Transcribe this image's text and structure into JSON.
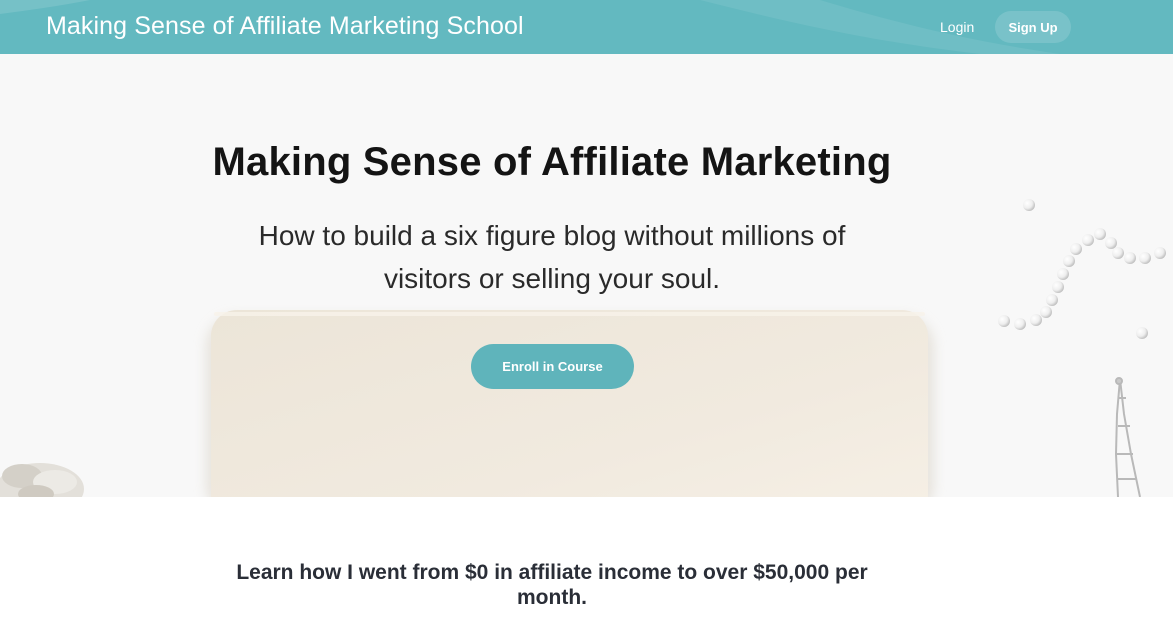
{
  "header": {
    "brand": "Making Sense of Affiliate Marketing School",
    "login_label": "Login",
    "signup_label": "Sign Up",
    "bar_color": "#63b9c0"
  },
  "hero": {
    "title": "Making Sense of Affiliate Marketing",
    "subtitle": "How to build a six figure blog without millions of visitors or selling your soul.",
    "cta_label": "Enroll in Course",
    "cta_color": "#5fb4bb",
    "decor_icons": [
      "laptop-image",
      "pearl-necklace-image",
      "eiffel-tower-image",
      "flower-image"
    ]
  },
  "intro": {
    "text": "Learn how I went from $0 in affiliate income to over $50,000 per month."
  }
}
